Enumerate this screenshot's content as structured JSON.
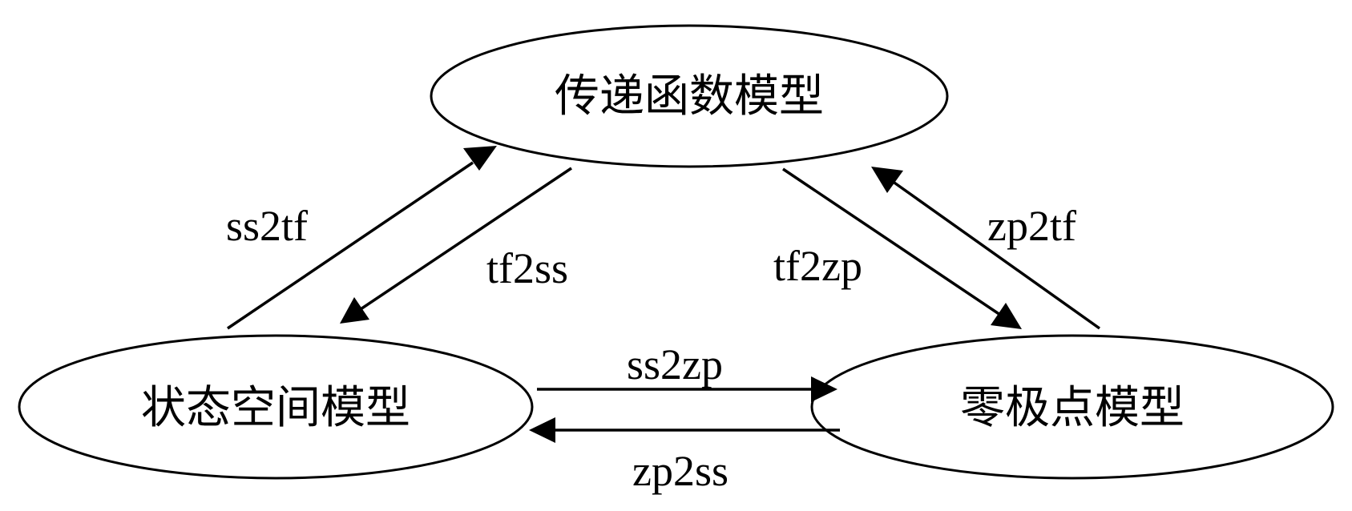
{
  "nodes": {
    "transfer_function": {
      "label": "传递函数模型"
    },
    "state_space": {
      "label": "状态空间模型"
    },
    "zero_pole": {
      "label": "零极点模型"
    }
  },
  "edges": {
    "ss2tf": {
      "label": "ss2tf",
      "from": "state_space",
      "to": "transfer_function"
    },
    "tf2ss": {
      "label": "tf2ss",
      "from": "transfer_function",
      "to": "state_space"
    },
    "tf2zp": {
      "label": "tf2zp",
      "from": "transfer_function",
      "to": "zero_pole"
    },
    "zp2tf": {
      "label": "zp2tf",
      "from": "zero_pole",
      "to": "transfer_function"
    },
    "ss2zp": {
      "label": "ss2zp",
      "from": "state_space",
      "to": "zero_pole"
    },
    "zp2ss": {
      "label": "zp2ss",
      "from": "zero_pole",
      "to": "state_space"
    }
  }
}
